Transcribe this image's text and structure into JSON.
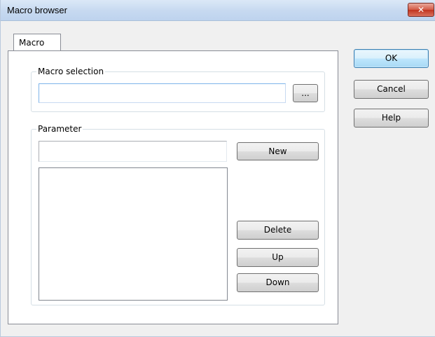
{
  "window": {
    "title": "Macro browser",
    "close_glyph": "✕"
  },
  "tabs": [
    {
      "label": "Macro",
      "active": true
    }
  ],
  "macro_selection": {
    "group_label": "Macro selection",
    "input_value": "",
    "browse_label": "..."
  },
  "parameter": {
    "group_label": "Parameter",
    "input_value": "",
    "new_label": "New",
    "delete_label": "Delete",
    "up_label": "Up",
    "down_label": "Down",
    "items": []
  },
  "dialog_buttons": {
    "ok_label": "OK",
    "cancel_label": "Cancel",
    "help_label": "Help"
  },
  "colors": {
    "accent": "#3c7fb1",
    "close_red": "#c1331f"
  }
}
